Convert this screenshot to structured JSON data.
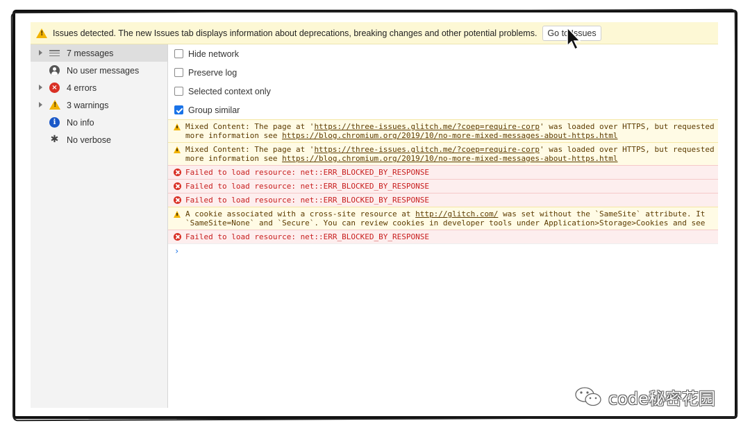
{
  "banner": {
    "text": "Issues detected. The new Issues tab displays information about deprecations, breaking changes and other potential problems.",
    "button_label": "Go to Issues"
  },
  "sidebar": {
    "items": [
      {
        "label": "7 messages",
        "icon": "list-icon",
        "expandable": true,
        "selected": true
      },
      {
        "label": "No user messages",
        "icon": "user-icon",
        "expandable": false
      },
      {
        "label": "4 errors",
        "icon": "error-icon",
        "expandable": true
      },
      {
        "label": "3 warnings",
        "icon": "warning-icon",
        "expandable": true
      },
      {
        "label": "No info",
        "icon": "info-icon",
        "expandable": false
      },
      {
        "label": "No verbose",
        "icon": "bug-icon",
        "expandable": false
      }
    ]
  },
  "options": [
    {
      "label": "Hide network",
      "checked": false
    },
    {
      "label": "Preserve log",
      "checked": false
    },
    {
      "label": "Selected context only",
      "checked": false
    },
    {
      "label": "Group similar",
      "checked": true
    }
  ],
  "messages": [
    {
      "level": "warning",
      "line1_pre": "Mixed Content: The page at '",
      "line1_link": "https://three-issues.glitch.me/?coep=require-corp",
      "line1_post": "' was loaded over HTTPS, but requested",
      "line2_pre": "more information see ",
      "line2_link": "https://blog.chromium.org/2019/10/no-more-mixed-messages-about-https.html"
    },
    {
      "level": "warning",
      "line1_pre": "Mixed Content: The page at '",
      "line1_link": "https://three-issues.glitch.me/?coep=require-corp",
      "line1_post": "' was loaded over HTTPS, but requested",
      "line2_pre": "more information see ",
      "line2_link": "https://blog.chromium.org/2019/10/no-more-mixed-messages-about-https.html"
    },
    {
      "level": "error",
      "text": "Failed to load resource: net::ERR_BLOCKED_BY_RESPONSE"
    },
    {
      "level": "error",
      "text": "Failed to load resource: net::ERR_BLOCKED_BY_RESPONSE"
    },
    {
      "level": "error",
      "text": "Failed to load resource: net::ERR_BLOCKED_BY_RESPONSE"
    },
    {
      "level": "warning",
      "line1_pre": "A cookie associated with a cross-site resource at ",
      "line1_link": "http://glitch.com/",
      "line1_post": " was set without the `SameSite` attribute. It",
      "line2_pre": "`SameSite=None` and `Secure`. You can review cookies in developer tools under Application>Storage>Cookies and see",
      "line2_link": ""
    },
    {
      "level": "error",
      "text": "Failed to load resource: net::ERR_BLOCKED_BY_RESPONSE"
    }
  ],
  "prompt_symbol": "›",
  "watermark": {
    "text": "code秘密花园"
  },
  "colors": {
    "banner_bg": "#fdf8d5",
    "error_text": "#c81e1e",
    "warning_text": "#5c3b00",
    "checkbox_accent": "#1a73e8"
  }
}
